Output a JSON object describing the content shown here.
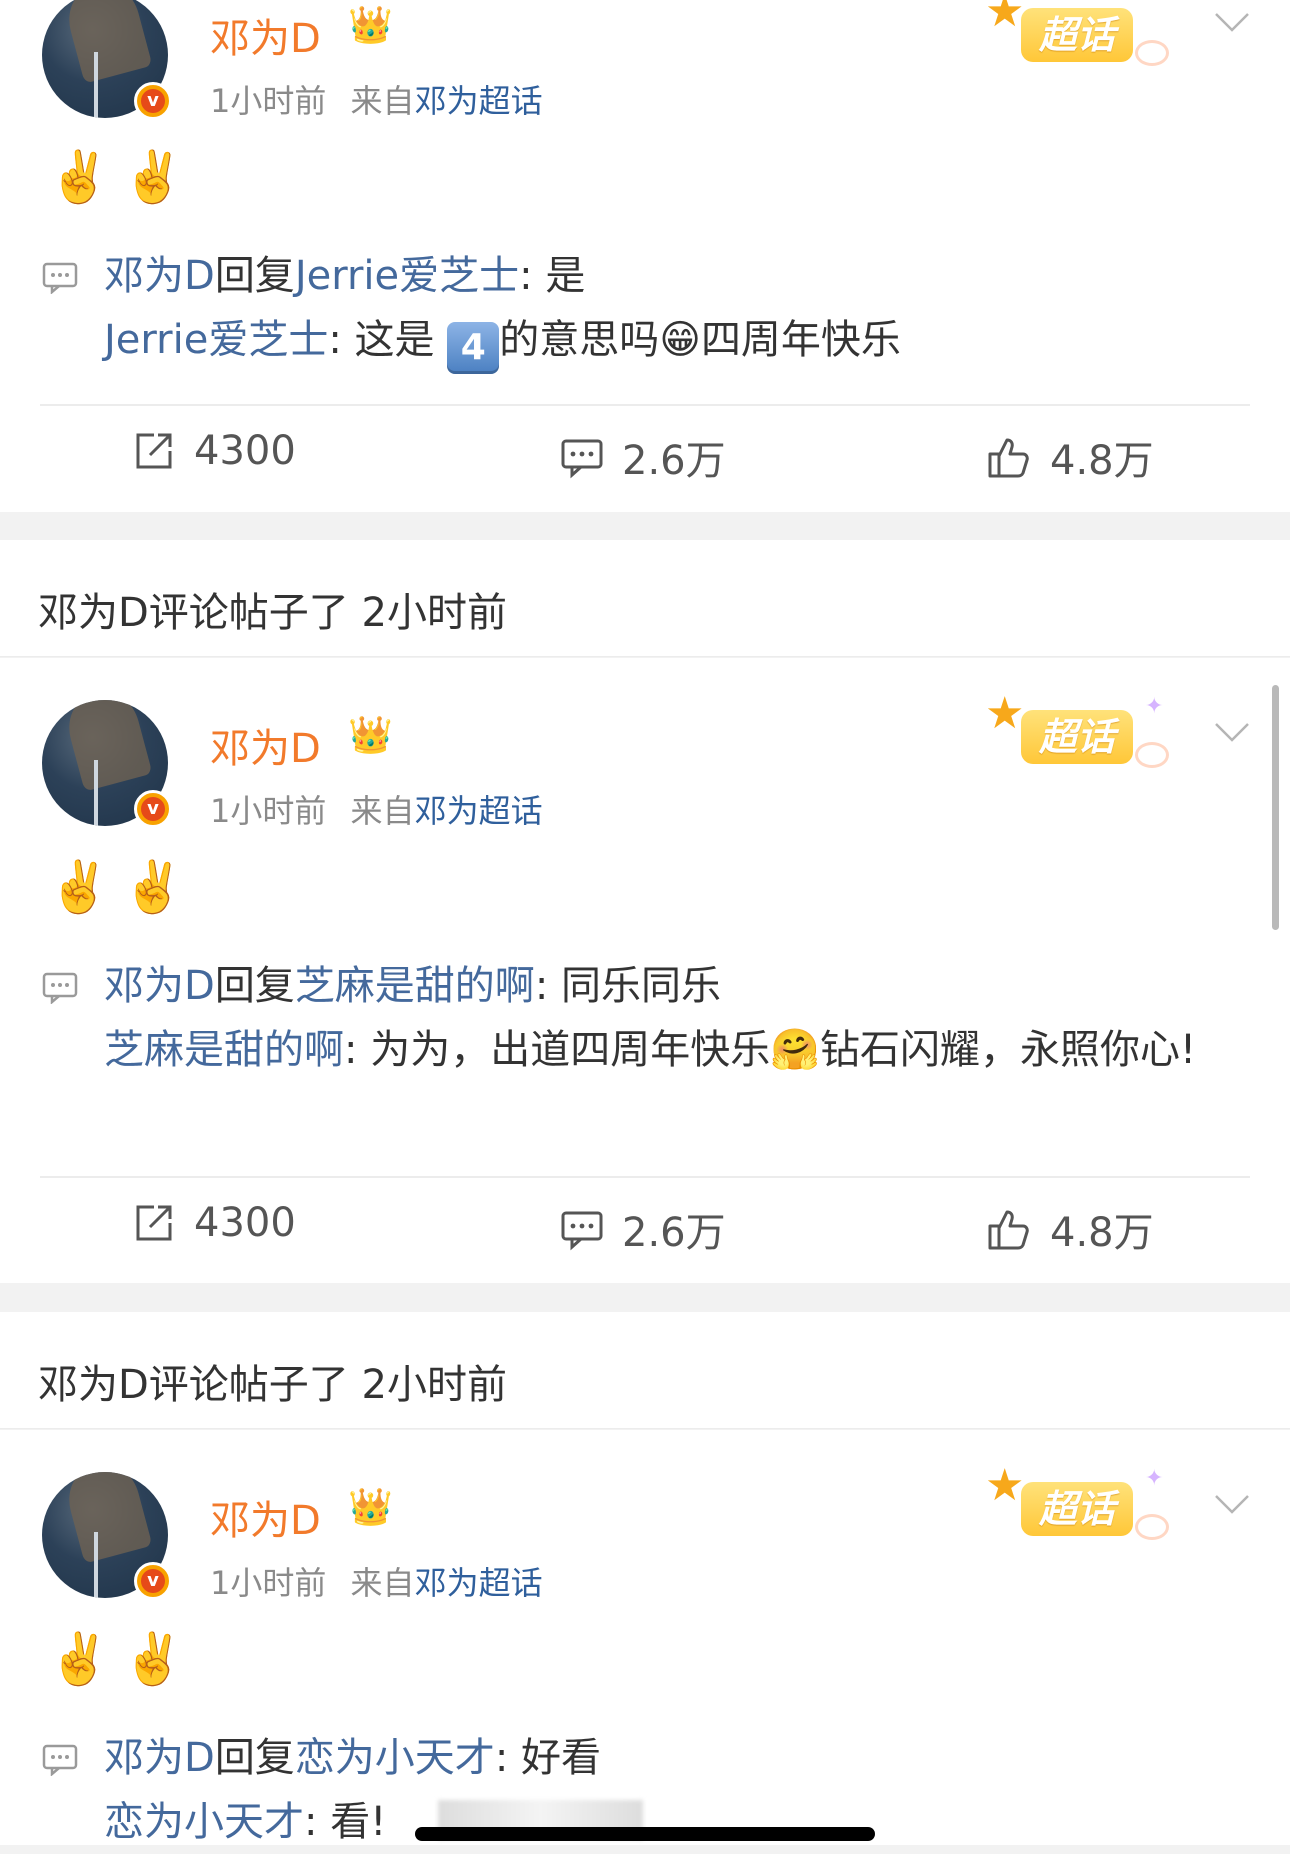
{
  "cards": [
    {
      "author": "邓为D",
      "time": "1小时前",
      "from_label": "来自",
      "source": "邓为超话",
      "supertopic_badge": "超话",
      "emojis": "✌️✌️",
      "reply_author": "邓为D",
      "reply_word": "回复",
      "reply_target": "Jerrie爱芝士",
      "reply_text": ": 是",
      "quote_author": "Jerrie爱芝士",
      "quote_text_a": ": 这是 ",
      "quote_keycap": "4",
      "quote_text_b": "的意思吗",
      "quote_emoji": "😁",
      "quote_text_c": "四周年快乐",
      "repost_count": "4300",
      "comment_count": "2.6万",
      "like_count": "4.8万"
    },
    {
      "author": "邓为D",
      "time": "1小时前",
      "from_label": "来自",
      "source": "邓为超话",
      "supertopic_badge": "超话",
      "emojis": "✌️✌️",
      "reply_author": "邓为D",
      "reply_word": "回复",
      "reply_target": "芝麻是甜的啊",
      "reply_text": ": 同乐同乐",
      "quote_author": "芝麻是甜的啊",
      "quote_text_a": ": 为为，出道四周年快乐",
      "quote_emoji": "🤗",
      "quote_text_b": "钻石闪耀，永照你心!",
      "repost_count": "4300",
      "comment_count": "2.6万",
      "like_count": "4.8万"
    },
    {
      "author": "邓为D",
      "time": "1小时前",
      "from_label": "来自",
      "source": "邓为超话",
      "supertopic_badge": "超话",
      "emojis": "✌️✌️",
      "reply_author": "邓为D",
      "reply_word": "回复",
      "reply_target": "恋为小天才",
      "reply_text": ": 好看",
      "quote_author": "恋为小天才",
      "quote_text_a": ": 看!"
    }
  ],
  "section_headers": [
    {
      "text": "邓为D评论帖子了 2小时前"
    },
    {
      "text": "邓为D评论帖子了 2小时前"
    }
  ],
  "icons": [
    "crown-icon",
    "verified-icon",
    "comment-reply-icon",
    "repost-icon",
    "comment-icon",
    "like-icon",
    "chevron-down-icon"
  ],
  "colors": {
    "author_name": "#f27a2b",
    "link": "#44699c",
    "meta": "#8a8a8a",
    "badge": "#ffc738",
    "background": "#f2f2f2"
  }
}
